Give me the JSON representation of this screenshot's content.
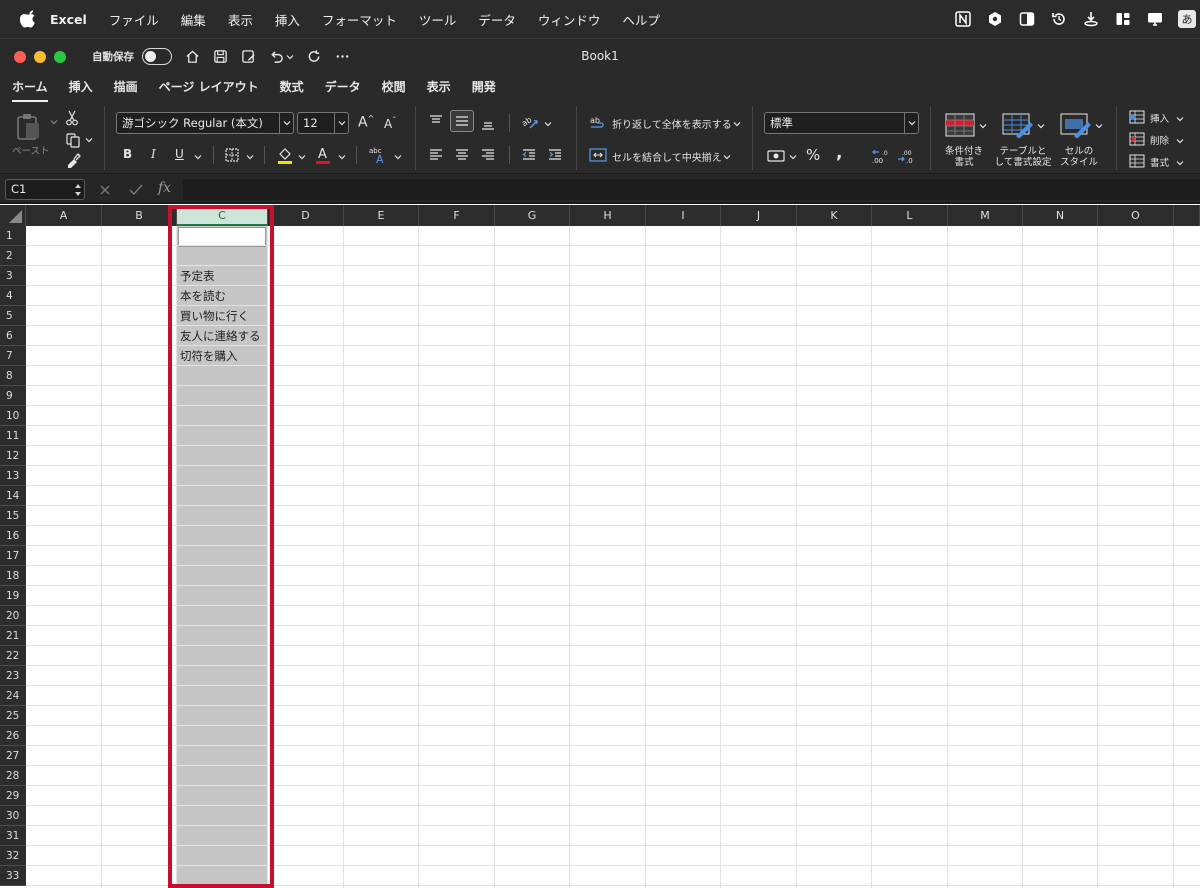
{
  "menubar": {
    "app_name": "Excel",
    "items": [
      "ファイル",
      "編集",
      "表示",
      "挿入",
      "フォーマット",
      "ツール",
      "データ",
      "ウィンドウ",
      "ヘルプ"
    ],
    "ime_label": "あ"
  },
  "window": {
    "title": "Book1",
    "autosave_label": "自動保存"
  },
  "ribbon_tabs": [
    "ホーム",
    "挿入",
    "描画",
    "ページ レイアウト",
    "数式",
    "データ",
    "校閲",
    "表示",
    "開発"
  ],
  "ribbon": {
    "paste_label": "ペースト",
    "font_name": "游ゴシック Regular (本文)",
    "font_size": "12",
    "bold": "B",
    "italic": "I",
    "underline": "U",
    "wrap_text": "折り返して全体を表示する",
    "merge_center": "セルを結合して中央揃え",
    "number_format": "標準",
    "percent": "%",
    "comma": ",",
    "conditional_format": [
      "条件付き",
      "書式"
    ],
    "format_table": [
      "テーブルと",
      "して書式設定"
    ],
    "cell_styles": [
      "セルの",
      "スタイル"
    ],
    "insert": "挿入",
    "delete": "削除",
    "format": "書式"
  },
  "formula_bar": {
    "name_box": "C1",
    "fx": "fx",
    "content": ""
  },
  "grid": {
    "columns": [
      "A",
      "B",
      "C",
      "D",
      "E",
      "F",
      "G",
      "H",
      "I",
      "J",
      "K",
      "L",
      "M",
      "N",
      "O"
    ],
    "selected_column": "C",
    "rows": [
      "1",
      "2",
      "3",
      "4",
      "5",
      "6",
      "7",
      "8",
      "9",
      "10",
      "11",
      "12",
      "13",
      "14",
      "15",
      "16",
      "17",
      "18",
      "19",
      "20",
      "21",
      "22",
      "23",
      "24",
      "25",
      "26",
      "27",
      "28",
      "29",
      "30",
      "31",
      "32",
      "33"
    ],
    "cells": {
      "C3": "予定表",
      "C4": "本を読む",
      "C5": "買い物に行く",
      "C6": "友人に連絡する",
      "C7": "切符を購入"
    }
  },
  "colors": {
    "selection_highlight": "#c8102e",
    "selected_header": "#cde4d6",
    "selected_column_fill": "#c6c6c6"
  }
}
